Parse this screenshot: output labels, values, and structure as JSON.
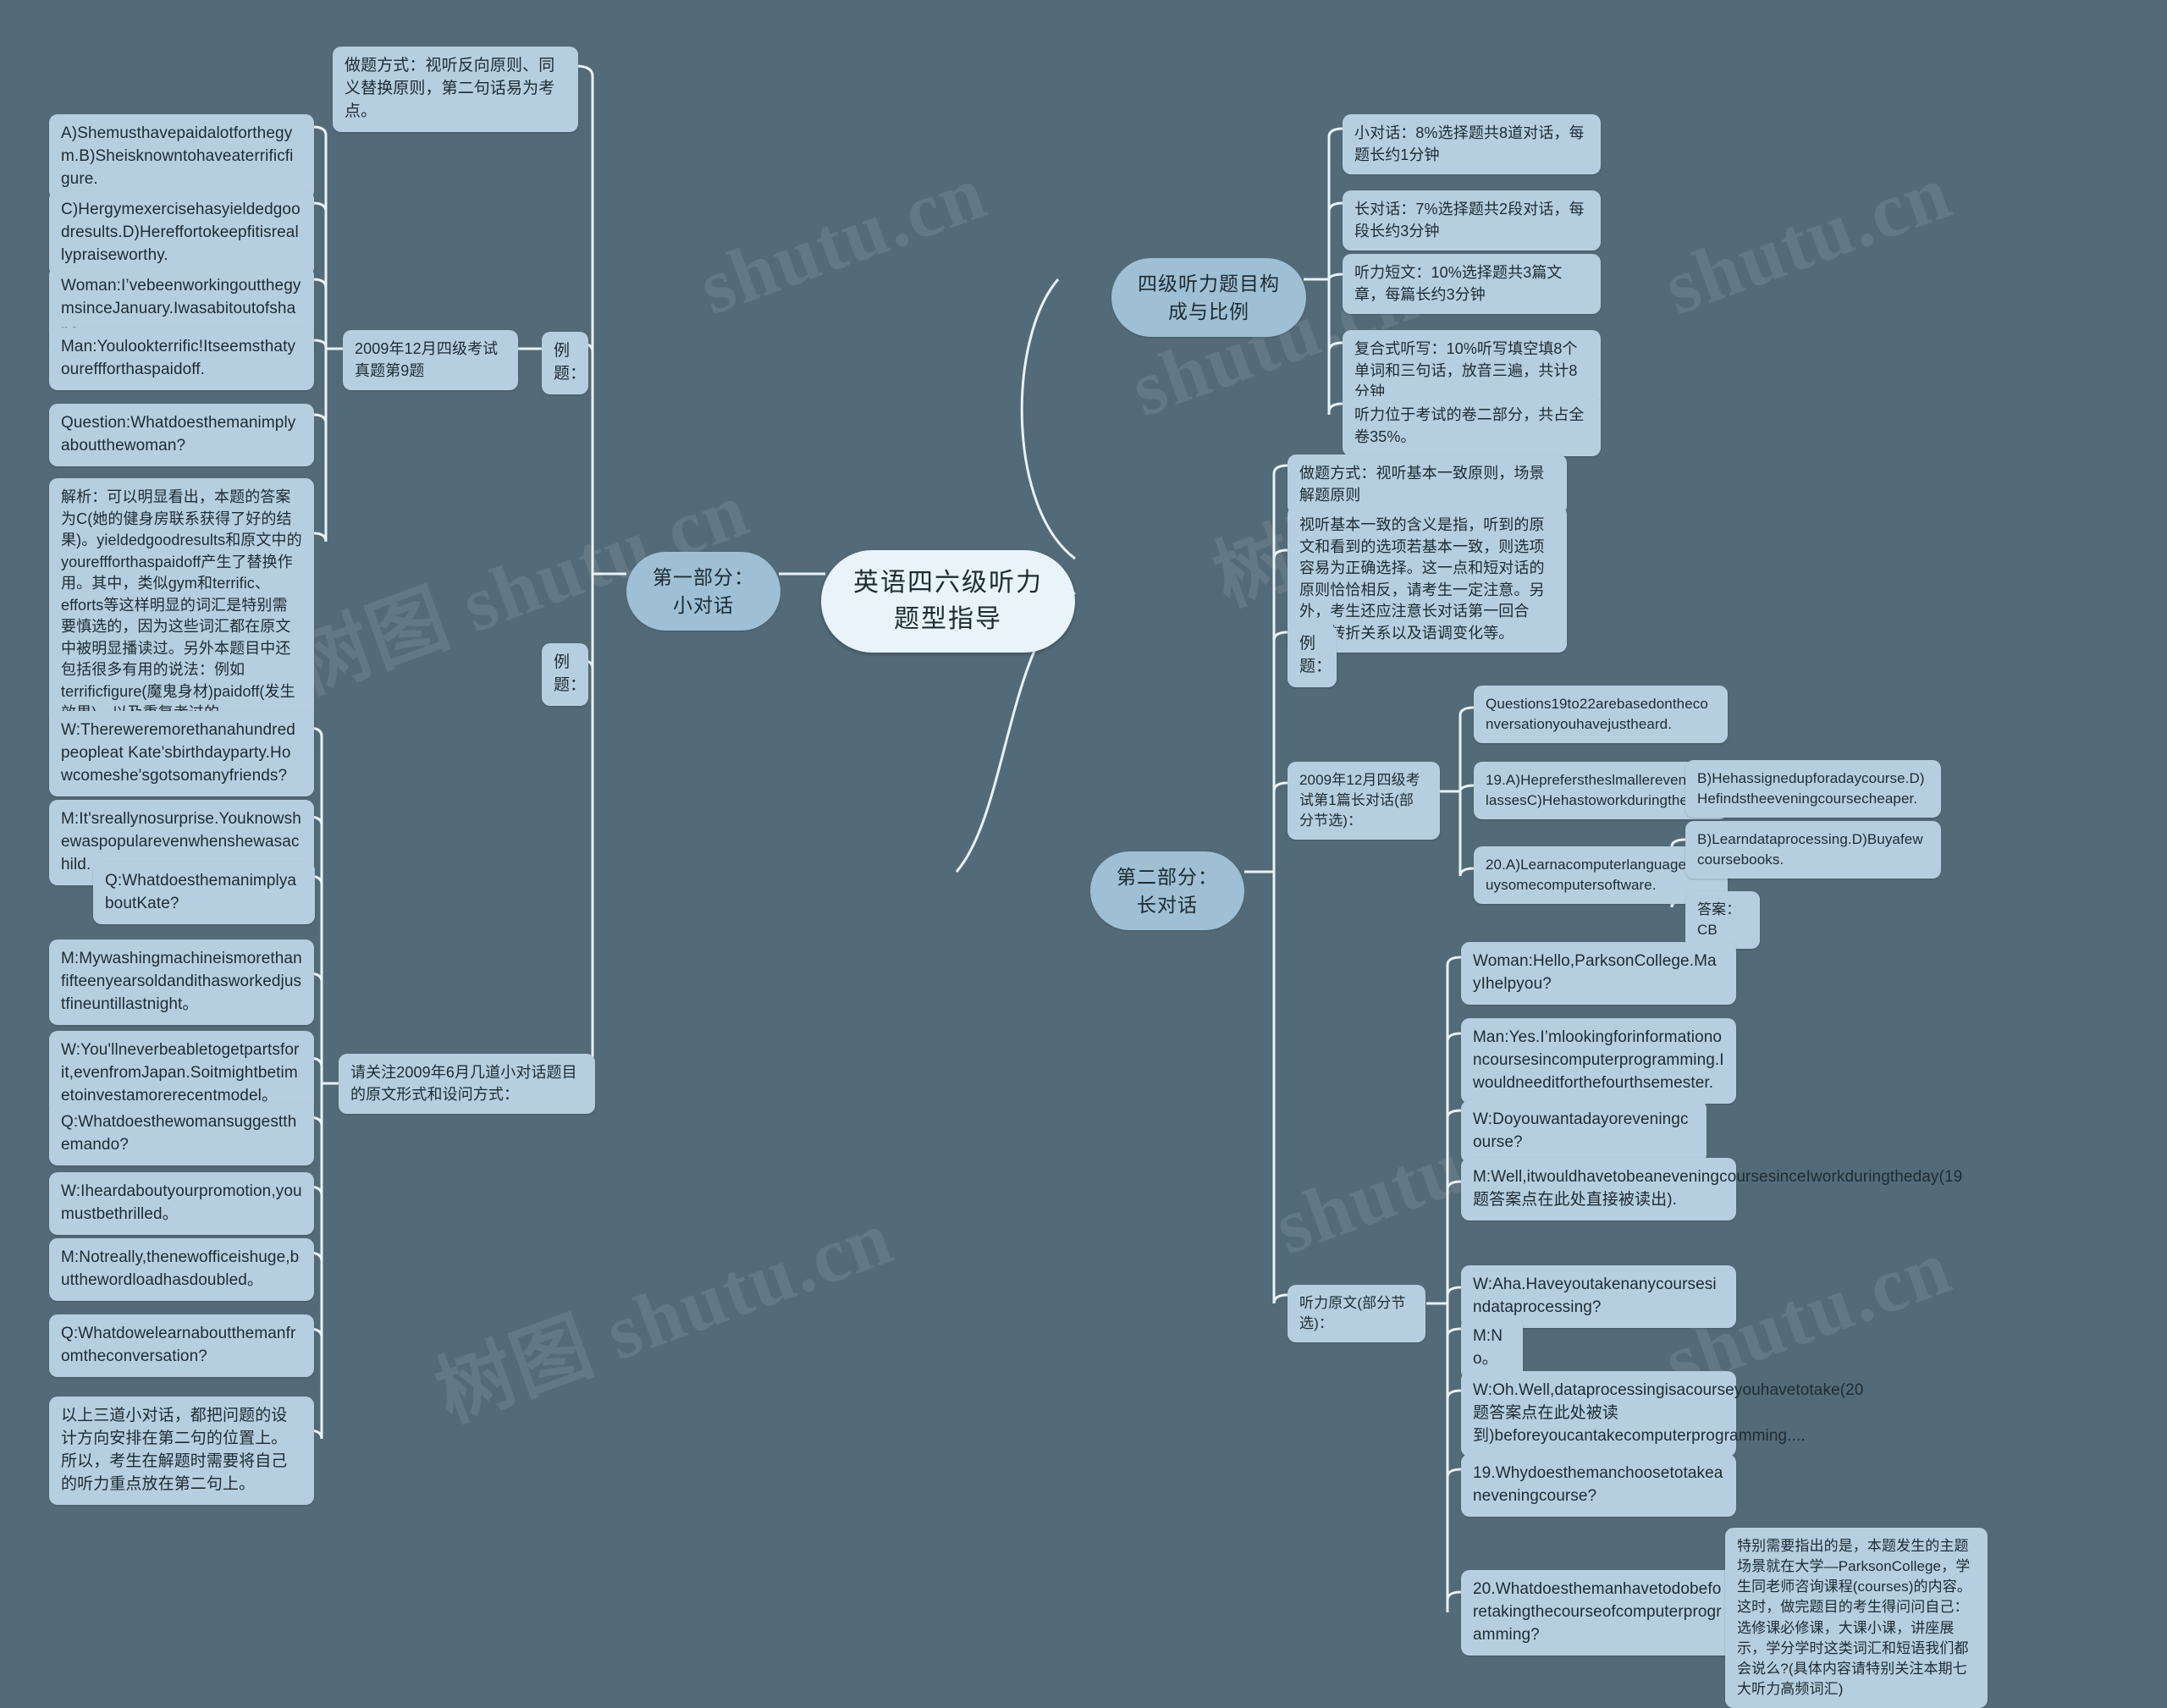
{
  "meta": {
    "root_title": "英语四六级听力题型指导",
    "background_color": "#536b78",
    "node_color": "#b6cfe0",
    "branch_color": "#9fc0d4",
    "root_color": "#e8f3fa",
    "watermarks": [
      "shutu.cn",
      "树图 shutu.cn",
      "shutu.cn",
      "树图 shutu.cn",
      "shutu.cn",
      "树图 shutu.cn"
    ]
  },
  "branches": {
    "part1": "第一部分：小对话",
    "part2": "第二部分：长对话",
    "structure": "四级听力题目构成与比例"
  },
  "part1": {
    "method": "做题方式：视听反向原则、同义替换原则，第二句话易为考点。",
    "example_label_top": "例题：",
    "exam_source": "2009年12月四级考试真题第9题",
    "options_ab": "A)Shemusthavepaidalotforthegym.B)Sheisknowntohaveaterrificfigure.",
    "options_cd": "C)Hergymexercisehasyieldedgoodresults.D)Hereffortokeepfitisreallypraiseworthy.",
    "woman_line": "Woman:I’vebeenworkingoutthegymsinceJanuary.Iwasabitoutofshape.",
    "man_line": "Man:Youlookterrific!Itseemsthatyoureffforthaspaidoff.",
    "question_line": "Question:Whatdoesthemanimplyaboutthewoman?",
    "analysis": "解析：可以明显看出，本题的答案为C(她的健身房联系获得了好的结果)。yieldedgoodresults和原文中的youreffforthaspaidoff产生了替换作用。其中，类似gym和terrific、efforts等这样明显的词汇是特别需要慎选的，因为这些词汇都在原文中被明显播读过。另外本题目中还包括很多有用的说法：例如terrificfigure(魔鬼身材)paidoff(发生效果)，以及重复考过的outofshape(身材走样)等等。",
    "example_label_bottom": "例题：",
    "focus_note": "请关注2009年6月几道小对话题目的原文形式和设问方式：",
    "dialogues": [
      "W:Thereweremorethanahundredpeopleat Kate'sbirthdayparty.Howcomeshe'sgotsomanyfriends?",
      "M:It'sreallynosurprise.Youknowshewaspopularevenwhenshewasachild.",
      "Q:WhatdoesthemanimplyaboutKate?",
      "M:Mywashingmachineismorethanfifteenyearsoldandithasworkedjustfineuntillastnight。",
      "W:You'llneverbeabletogetpartsforit,evenfromJapan.Soitmightbetimetoinvestamorerecentmodel。",
      "Q:Whatdoesthewomansuggestthemando?",
      "W:Iheardaboutyourpromotion,youmustbethrilled。",
      "M:Notreally,thenewofficeishuge,butthewordloadhasdoubled。",
      "Q:Whatdowelearnaboutthemanfromtheconversation?"
    ],
    "summary": "以上三道小对话，都把问题的设计方向安排在第二句的位置上。所以，考生在解题时需要将自己的听力重点放在第二句上。"
  },
  "structure": {
    "items": [
      "小对话：8%选择题共8道对话，每题长约1分钟",
      "长对话：7%选择题共2段对话，每段长约3分钟",
      "听力短文：10%选择题共3篇文章，每篇长约3分钟",
      "复合式听写：10%听写填空填8个单词和三句话，放音三遍，共计8分钟",
      "听力位于考试的卷二部分，共占全卷35%。"
    ]
  },
  "part2": {
    "method": "做题方式：视听基本一致原则，场景解题原则",
    "explanation": "视听基本一致的含义是指，听到的原文和看到的选项若基本一致，则选项容易为正确选择。这一点和短对话的原则恰恰相反，请考生一定注意。另外，考生还应注意长对话第一回合句，转折关系以及语调变化等。",
    "example_label": "例题：",
    "exam_source": "2009年12月四级考试第1篇长对话(部分节选)：",
    "question_intro": "Questions19to22arebasedontheconversationyouhavejustheard.",
    "q19_ac": "19.A)HepreferstheslmallereveningclassesC)Hehastoworkduringtheday.",
    "q19_bd": "B)Hehassignedupforadaycourse.D)Hefindstheeveningcoursecheaper.",
    "q20_ac": "20.A)Learnacomputerlanguage.C)Buysomecomputersoftware.",
    "q20_bd": "B)Learndataprocessing.D)Buyafewcoursebooks.",
    "answer": "答案：CB",
    "transcript_label": "听力原文(部分节选)：",
    "transcript": [
      "Woman:Hello,ParksonCollege.MayIhelpyou?",
      "Man:Yes.I’mlookingforinformationoncoursesincomputerprogramming.Iwouldneeditforthefourthsemester.",
      "W:Doyouwantadayoreveningcourse?",
      "M:Well,itwouldhavetobeaneveningcoursesinceIworkduringtheday(19题答案点在此处直接被读出).",
      "W:Aha.Haveyoutakenanycoursesindataprocessing?",
      "M:No。",
      "W:Oh.Well,dataprocessingisacourseyouhavetotake(20题答案点在此处被读到)beforeyoucantakecomputerprogramming....",
      "19.Whydoesthemanchoosetotakeaneveningcourse?",
      "20.Whatdoesthemanhavetodobeforetakingthecourseofcomputerprogramming?"
    ],
    "special_note": "特别需要指出的是，本题发生的主题场景就在大学—ParksonCollege，学生同老师咨询课程(courses)的内容。这时，做完题目的考生得问问自己：选修课必修课，大课小课，讲座展示，学分学时这类词汇和短语我们都会说么?(具体内容请特别关注本期七大听力高频词汇)"
  }
}
